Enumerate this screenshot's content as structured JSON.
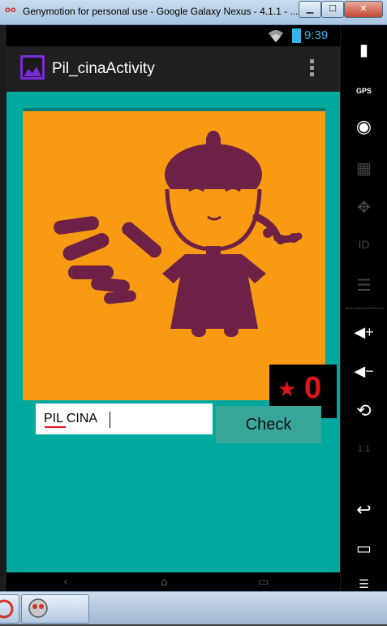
{
  "window": {
    "title": "Genymotion for personal use - Google Galaxy Nexus - 4.1.1 - ...",
    "app_icon": "genymotion-icon",
    "minimize_label": "▁",
    "maximize_label": "☐",
    "close_label": "✕"
  },
  "status_bar": {
    "time": "9:39",
    "wifi_icon": "wifi-icon",
    "battery_icon": "battery-icon"
  },
  "action_bar": {
    "title": "Pil_cinaActivity",
    "overflow_icon": "overflow-menu-icon"
  },
  "quiz": {
    "image_description_icon": "chinese-person-with-pills-image",
    "score": "0",
    "star_glyph": "★",
    "answer_value": "PIL CINA",
    "check_label": "Check"
  },
  "side_panel": {
    "battery_label": "▮",
    "gps_label": "GPS",
    "camera_label": "◉",
    "video_label": "▦",
    "dpad_label": "✥",
    "id_label": "ID",
    "rss_label": "☰",
    "volume_up_label": "◀+",
    "volume_down_label": "◀−",
    "rotate_label": "⟲",
    "scale_label": "1:1",
    "back_label": "↩",
    "recent_label": "▭",
    "menu_label": "☰"
  },
  "colors": {
    "content_bg": "#00a99d",
    "image_bg": "#f99a13",
    "figure": "#6e2146",
    "accent_blue": "#33b5e5",
    "score_red": "#e0141c"
  }
}
